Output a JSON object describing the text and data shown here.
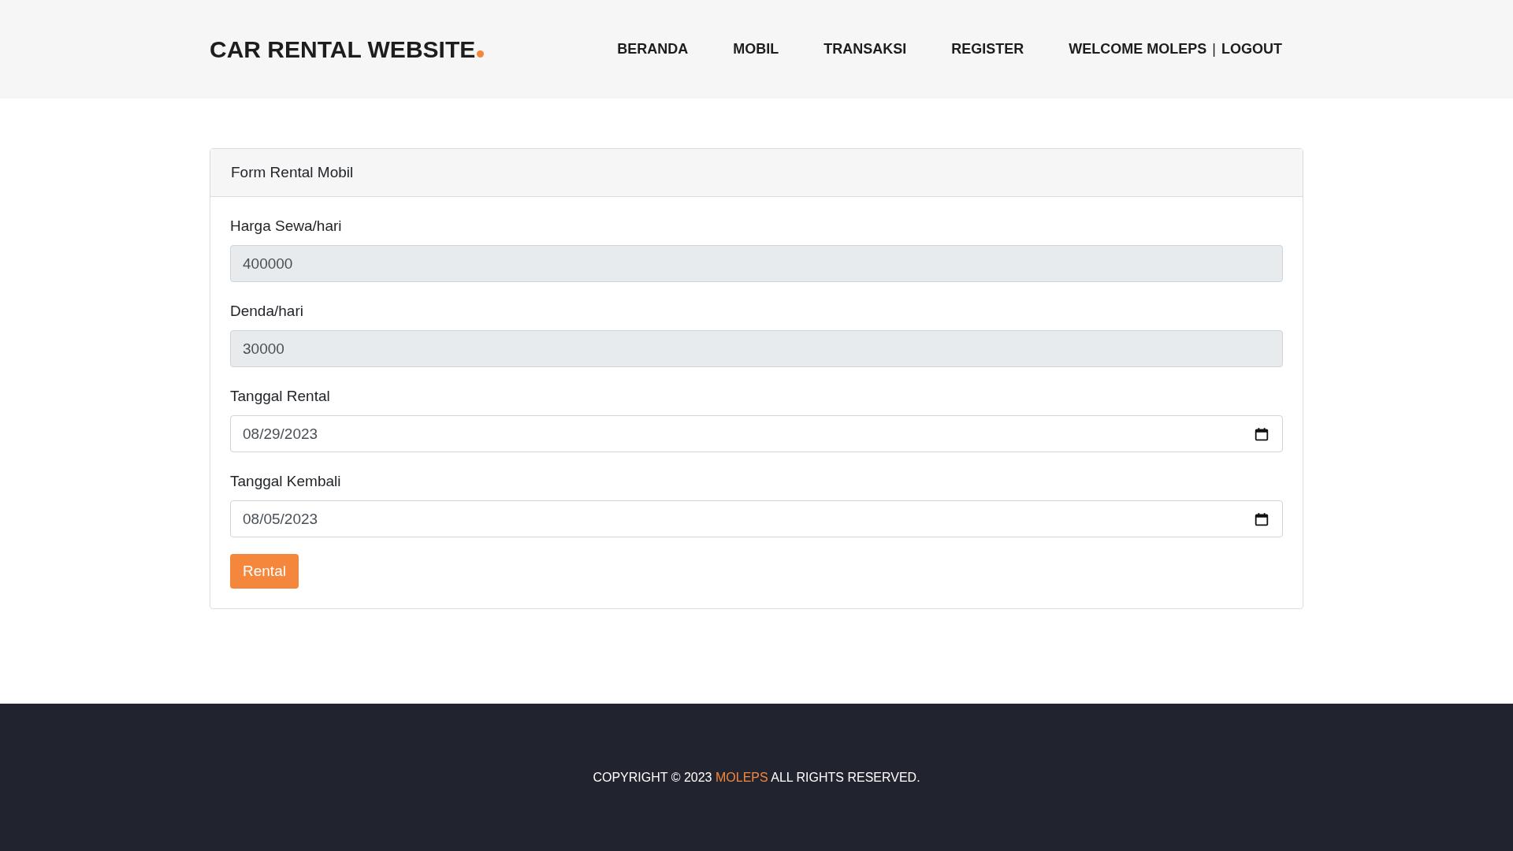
{
  "header": {
    "logo": "CAR RENTAL WEBSITE",
    "nav": [
      {
        "label": "BERANDA"
      },
      {
        "label": "MOBIL"
      },
      {
        "label": "TRANSAKSI"
      },
      {
        "label": "REGISTER"
      }
    ],
    "welcome": "WELCOME MOLEPS",
    "separator": "|",
    "logout": "LOGOUT"
  },
  "form": {
    "title": "Form Rental Mobil",
    "fields": [
      {
        "kind": "text",
        "label": "Harga Sewa/hari",
        "value": "400000",
        "disabled": true
      },
      {
        "kind": "text",
        "label": "Denda/hari",
        "value": "30000",
        "disabled": true
      },
      {
        "kind": "date",
        "label": "Tanggal Rental",
        "value": "08/29/2023",
        "disabled": false
      },
      {
        "kind": "date",
        "label": "Tanggal Kembali",
        "value": "08/05/2023",
        "disabled": false
      }
    ],
    "submit": "Rental"
  },
  "footer": {
    "before": "COPYRIGHT © 2023",
    "link": "MOLEPS",
    "after": "ALL RIGHTS RESERVED."
  }
}
